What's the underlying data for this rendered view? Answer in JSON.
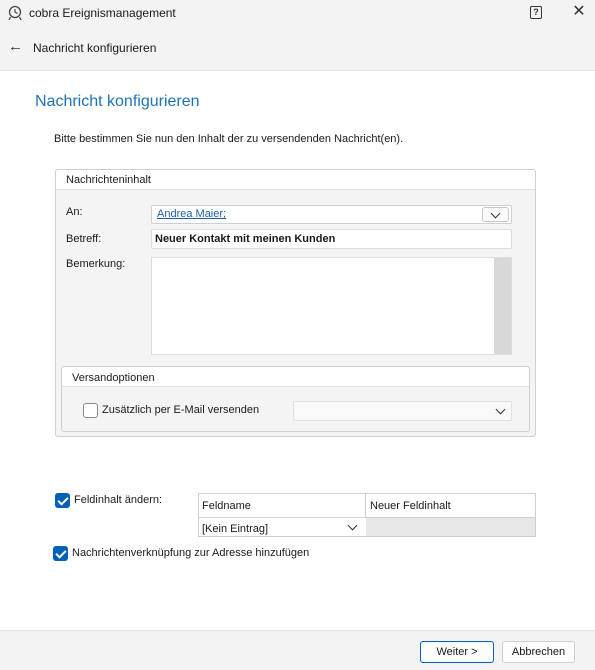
{
  "window": {
    "title": "cobra Ereignismanagement",
    "help_label": "?",
    "close_label": "✕"
  },
  "nav": {
    "back_label": "←",
    "title": "Nachricht konfigurieren"
  },
  "page": {
    "heading": "Nachricht konfigurieren",
    "instruction": "Bitte bestimmen Sie nun den Inhalt der zu versendenden Nachricht(en)."
  },
  "message": {
    "group_title": "Nachrichteninhalt",
    "to_label": "An:",
    "to_value": "Andrea Maier;",
    "subject_label": "Betreff:",
    "subject_value": "Neuer Kontakt mit meinen Kunden",
    "remark_label": "Bemerkung:",
    "remark_value": ""
  },
  "shipping": {
    "group_title": "Versandoptionen",
    "email_label": "Zusätzlich per E-Mail versenden",
    "email_checked": false,
    "email_select_value": ""
  },
  "field_change": {
    "label": "Feldinhalt ändern:",
    "checked": true,
    "columns": [
      "Feldname",
      "Neuer Feldinhalt"
    ],
    "row": {
      "fieldname": "[Kein Eintrag]",
      "new_value": ""
    }
  },
  "link_option": {
    "label": "Nachrichtenverknüpfung zur Adresse hinzufügen",
    "checked": true
  },
  "footer": {
    "next_label": "Weiter >",
    "cancel_label": "Abbrechen"
  }
}
